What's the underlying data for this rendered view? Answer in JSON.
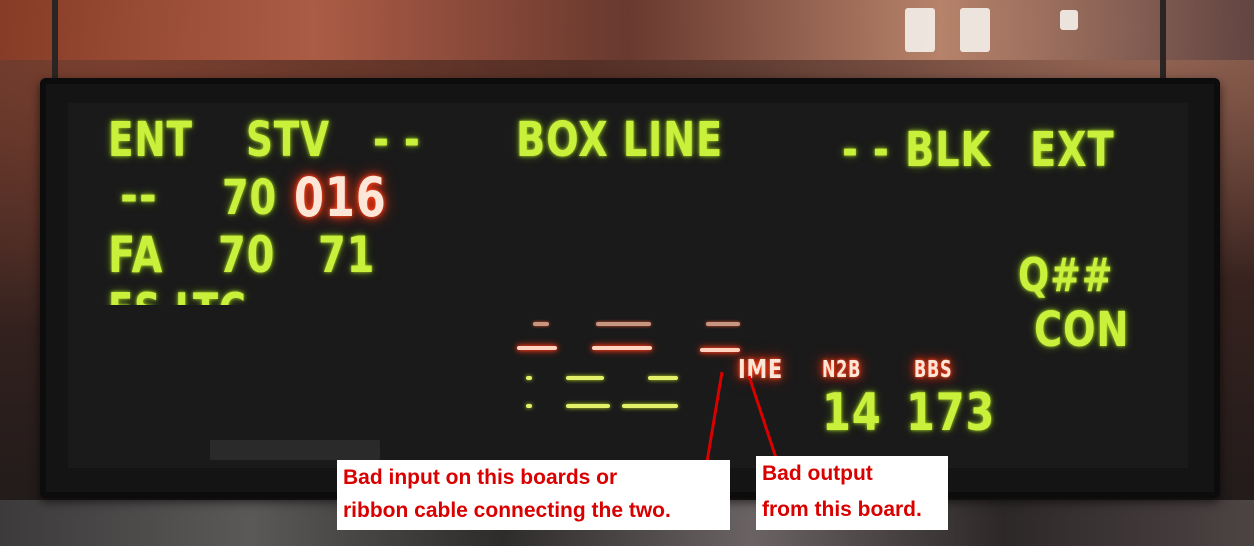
{
  "sign": {
    "row1": {
      "ent": "ENT",
      "stv": "STV",
      "dash_left": "- -",
      "box_line": "BOX LINE",
      "dash_right": "- -",
      "blk": "BLK",
      "ext": "EXT"
    },
    "row2": {
      "dashes": "--",
      "num_a": "70",
      "num_b": "016"
    },
    "row3": {
      "fa": "FA",
      "num_a": "70",
      "num_b": "71"
    },
    "row4": {
      "partial": "FS LTC"
    },
    "right": {
      "qnum": "Q##",
      "con": "CON"
    },
    "lower": {
      "ime": "IME",
      "n2b_label": "N2B",
      "bbs_label": "BBS",
      "n2b_value": "14",
      "bbs_value": "173"
    }
  },
  "annotations": {
    "left_line1": "Bad input on this boards or",
    "left_line2": "ribbon cable connecting the two.",
    "right_line1": "Bad output",
    "right_line2": "from this board."
  },
  "colors": {
    "led_green": "#c9f03a",
    "led_red": "#ff3a18",
    "annotation_red": "#d90000",
    "annotation_bg": "#ffffff"
  }
}
